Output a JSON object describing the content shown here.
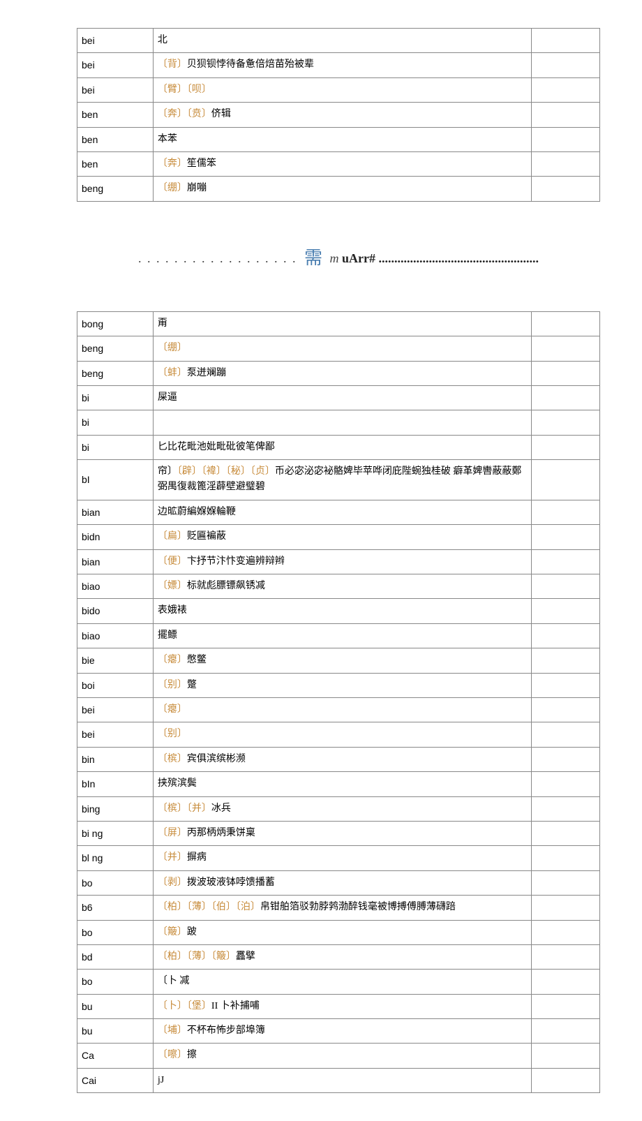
{
  "table1": [
    {
      "pinyin": "bei",
      "chars": "北"
    },
    {
      "pinyin": "bei",
      "chars": "〔背〕贝狈钡悖待备惫倍焙苗殆被辈"
    },
    {
      "pinyin": "bei",
      "chars": "〔臂〕〔呗〕"
    },
    {
      "pinyin": "ben",
      "chars": "〔奔〕〔贲〕侪辑"
    },
    {
      "pinyin": "ben",
      "chars": "本苯"
    },
    {
      "pinyin": "ben",
      "chars": "〔奔〕笙儒笨"
    },
    {
      "pinyin": "beng",
      "chars": "〔绷〕崩嘣"
    }
  ],
  "middle": {
    "dots_left": ". . . . . . . . . . . . . . . . . .",
    "char": "需",
    "italic_m": "m",
    "bold_text": "uArr#",
    "dots_right": "..................................................."
  },
  "table2": [
    {
      "pinyin": "bong",
      "chars": "甭"
    },
    {
      "pinyin": "beng",
      "chars": "〔绷〕"
    },
    {
      "pinyin": "beng",
      "chars": "〔蚌〕泵迸斓蹦"
    },
    {
      "pinyin": "bi",
      "chars": "屎逼"
    },
    {
      "pinyin": "bi",
      "chars": ""
    },
    {
      "pinyin": "bi",
      "chars": "匕比花毗池妣毗砒彼笔俾鄙"
    },
    {
      "pinyin": "bI",
      "chars": "帘〕〔辟〕〔褘〕〔秘〕〔贞〕币必宓泌宓袐骼婢毕苹哗闭庇陛蜿独桂破 癖革婢轡蔽蔽鄭弼禺復裁篦淫薜壁避璧碧"
    },
    {
      "pinyin": "bian",
      "chars": "边昿蔚編媬媬輪鞭"
    },
    {
      "pinyin": "bidn",
      "chars": "〔扁〕贬匾褊蔽"
    },
    {
      "pinyin": "bian",
      "chars": "〔便〕卞抒节汴忭变遍辨辩辫"
    },
    {
      "pinyin": "biao",
      "chars": "〔嫖〕标就彪膘镖飙锈减"
    },
    {
      "pinyin": "bido",
      "chars": "表娥裱"
    },
    {
      "pinyin": "biao",
      "chars": "擺鳔"
    },
    {
      "pinyin": "bie",
      "chars": "〔瘪〕憋鳖"
    },
    {
      "pinyin": "boi",
      "chars": "〔别〕蹩"
    },
    {
      "pinyin": "bei",
      "chars": "〔瘪〕"
    },
    {
      "pinyin": "bei",
      "chars": "〔别〕"
    },
    {
      "pinyin": "bin",
      "chars": "〔槟〕宾俱滨缤彬濒"
    },
    {
      "pinyin": "bIn",
      "chars": "挟殡滨鬓"
    },
    {
      "pinyin": "bing",
      "chars": "〔槟〕〔并〕冰兵"
    },
    {
      "pinyin": "bi ng",
      "chars": "〔屏〕丙那柄炳秉饼稟"
    },
    {
      "pinyin": "bl ng",
      "chars": "〔并〕摒病"
    },
    {
      "pinyin": "bo",
      "chars": "〔剥〕拨波玻液钵哱馈播蓄"
    },
    {
      "pinyin": "b6",
      "chars": "〔柏〕〔薄〕〔伯〕〔泊〕帛钳舶箔驳勃脖鹁渤醉钱毫被博搏傅膊薄礴踣"
    },
    {
      "pinyin": "bo",
      "chars": "〔簸〕跛"
    },
    {
      "pinyin": "bd",
      "chars": "〔柏〕〔薄〕〔簸〕靐擘"
    },
    {
      "pinyin": "bo",
      "chars": "〔卜 减"
    },
    {
      "pinyin": "bu",
      "chars": "〔卜〕〔堡〕II 卜补捕哺"
    },
    {
      "pinyin": "bu",
      "chars": "〔埔〕不杯布怖步部埠簿"
    },
    {
      "pinyin": "Ca",
      "chars": "〔嚓〕擦"
    },
    {
      "pinyin": "Cai",
      "chars": "jJ"
    }
  ]
}
